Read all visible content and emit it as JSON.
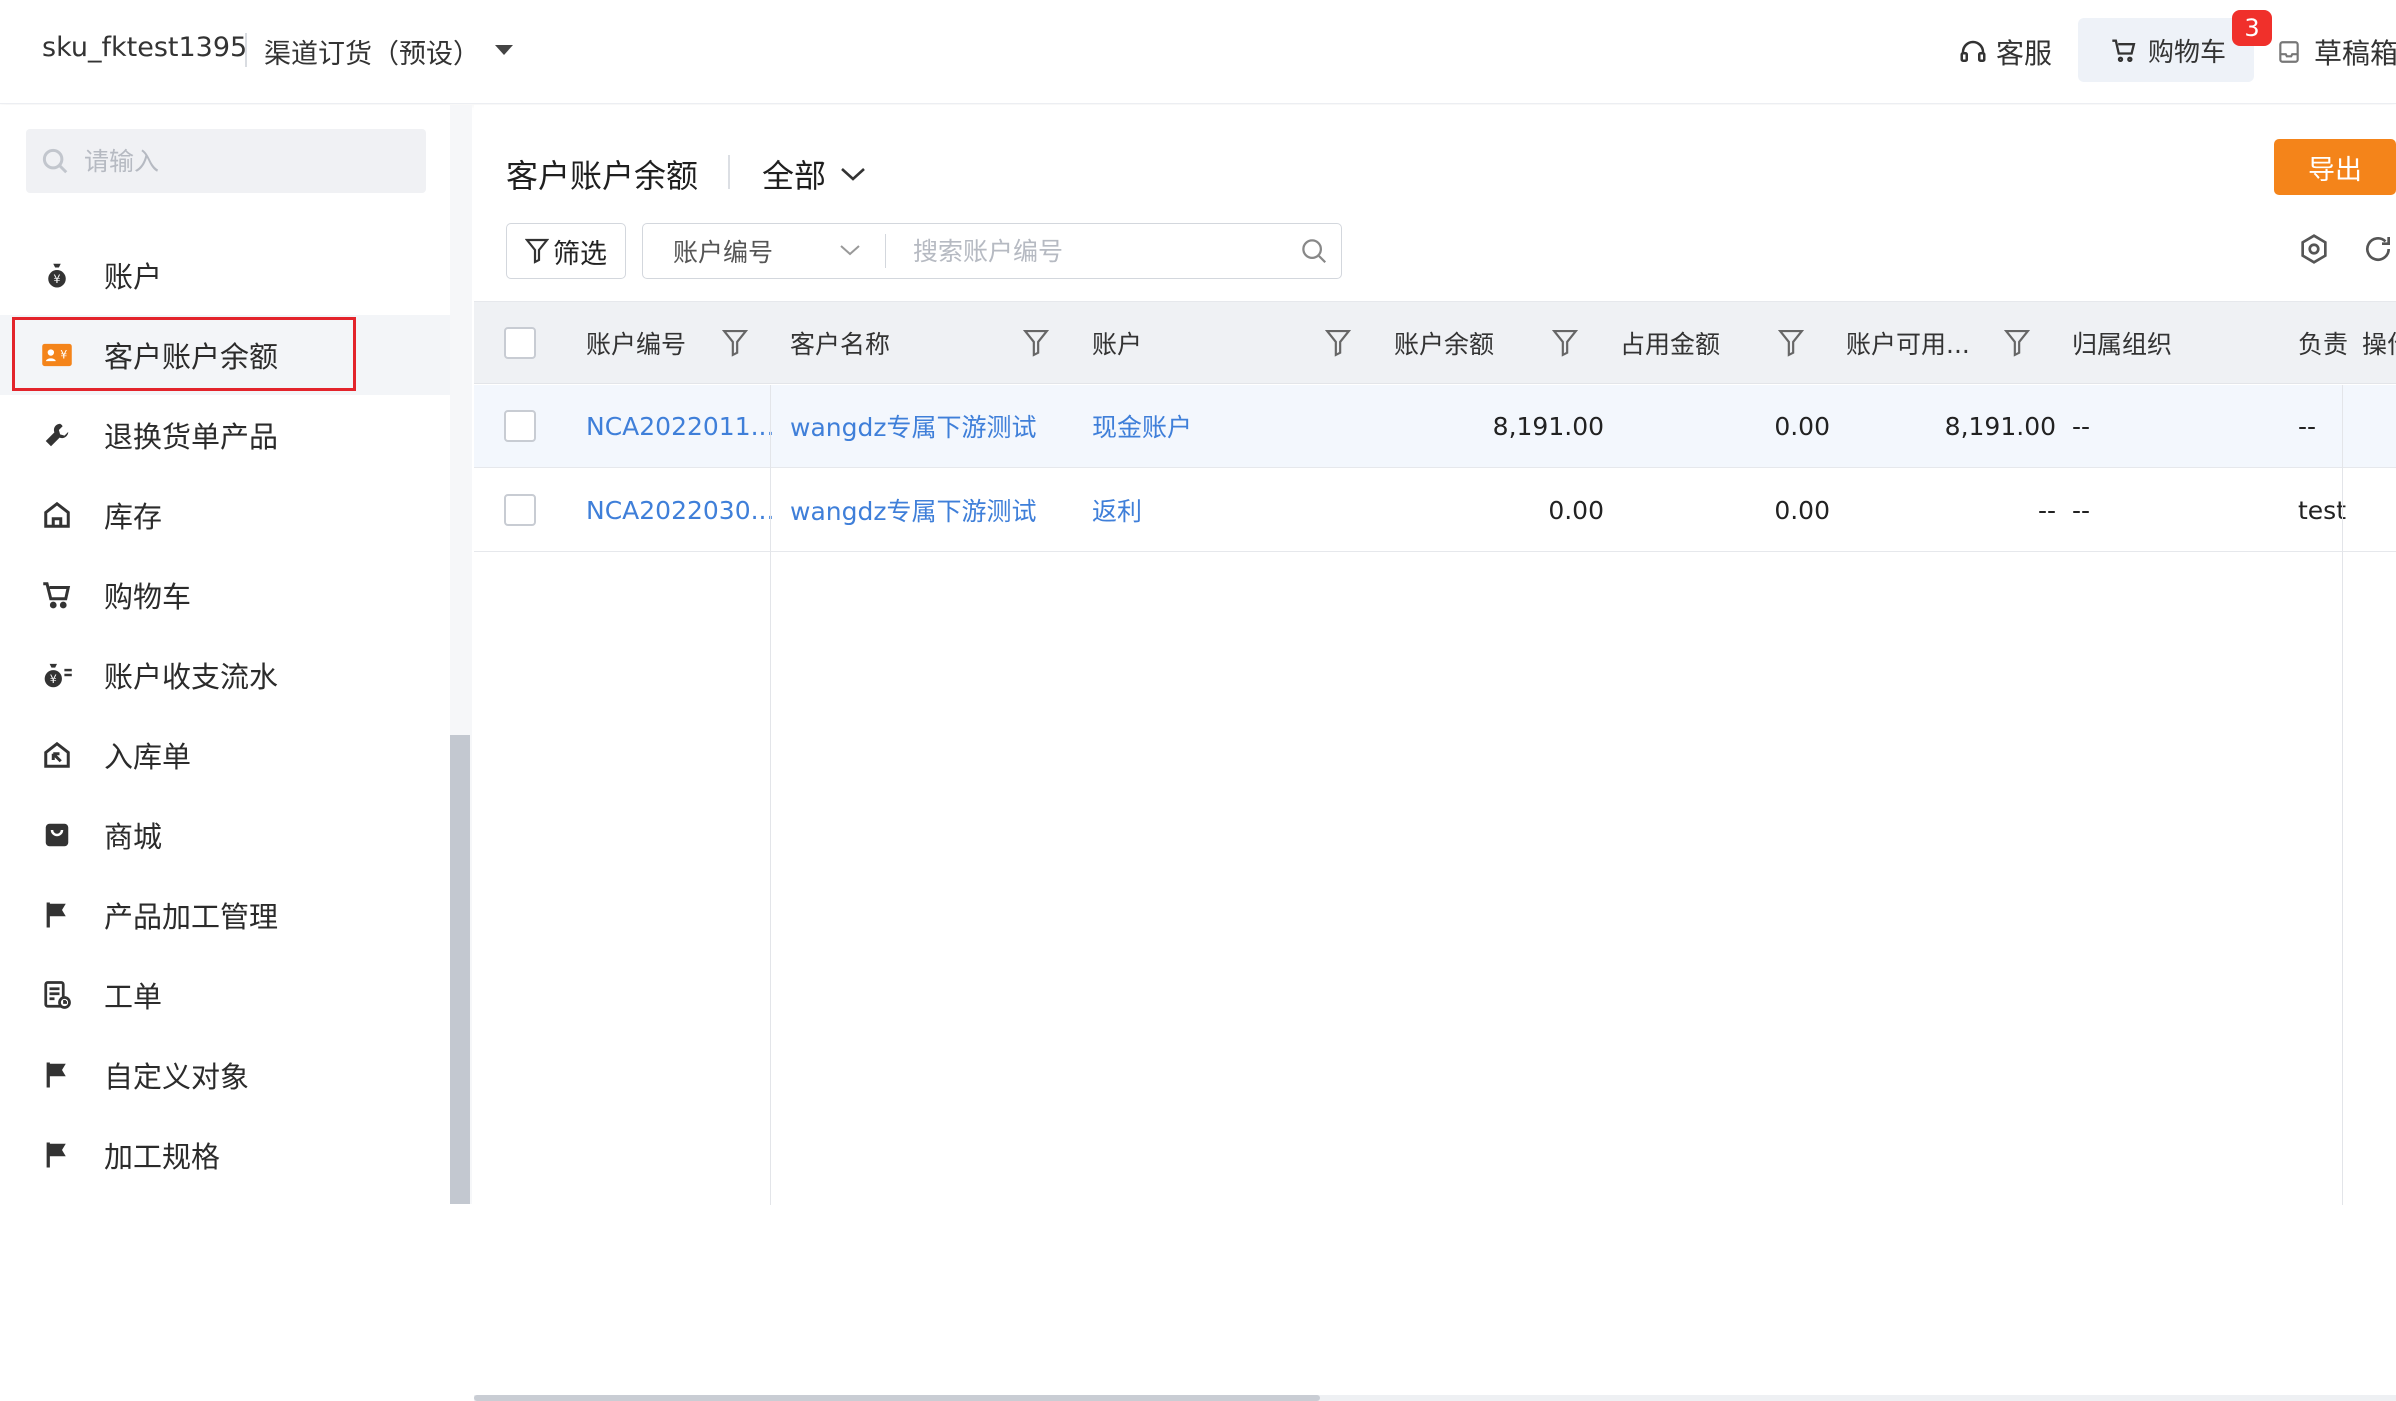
{
  "topbar": {
    "user": "sku_fktest1395",
    "org": "渠道订货（预设）",
    "service_label": "客服",
    "cart_label": "购物车",
    "cart_badge": "3",
    "draft_label": "草稿箱"
  },
  "sidebar": {
    "search_placeholder": "请输入",
    "items": [
      {
        "label": "账户",
        "icon": "money-bag-icon"
      },
      {
        "label": "客户账户余额",
        "icon": "account-card-icon",
        "active": true
      },
      {
        "label": "退换货单产品",
        "icon": "wrench-icon"
      },
      {
        "label": "库存",
        "icon": "warehouse-icon"
      },
      {
        "label": "购物车",
        "icon": "cart-icon"
      },
      {
        "label": "账户收支流水",
        "icon": "money-flow-icon"
      },
      {
        "label": "入库单",
        "icon": "inbound-icon"
      },
      {
        "label": "商城",
        "icon": "shopping-bag-icon"
      },
      {
        "label": "产品加工管理",
        "icon": "flag-icon"
      },
      {
        "label": "工单",
        "icon": "work-order-icon"
      },
      {
        "label": "自定义对象",
        "icon": "flag-icon"
      },
      {
        "label": "加工规格",
        "icon": "flag-icon"
      }
    ]
  },
  "main": {
    "title": "客户账户余额",
    "view": "全部",
    "export_label": "导出",
    "filter_label": "筛选",
    "search_field": "账户编号",
    "search_placeholder": "搜索账户编号"
  },
  "table": {
    "columns": [
      "账户编号",
      "客户名称",
      "账户",
      "账户余额",
      "占用金额",
      "账户可用...",
      "归属组织",
      "负责",
      "操作"
    ],
    "rows": [
      [
        "NCA2022011...",
        "wangdz专属下游测试",
        "现金账户",
        "8,191.00",
        "0.00",
        "8,191.00",
        "--",
        "--"
      ],
      [
        "NCA2022030...",
        "wangdz专属下游测试",
        "返利",
        "0.00",
        "0.00",
        "--",
        "--",
        "test"
      ]
    ]
  },
  "colors": {
    "accent": "#f4841a",
    "link": "#3f7fd9",
    "badge": "#f0302b",
    "highlight_box": "#e3242b",
    "account_icon": "#f4841a"
  }
}
